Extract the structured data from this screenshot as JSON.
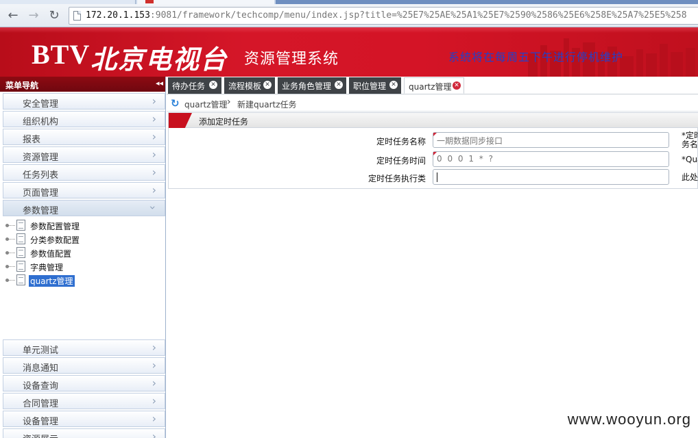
{
  "browser": {
    "url_host": "172.20.1.153",
    "url_rest": ":9081/framework/techcomp/menu/index.jsp?title=%25E7%25AE%25A1%25E7%2590%2586%25E6%258E%25A7%25E5%258"
  },
  "banner": {
    "logo_btv": "BTV",
    "logo_cn": "北京电视台",
    "system_name": "资源管理系统",
    "maintenance_notice": "系统将在每周五下午进行停机维护"
  },
  "sidebar": {
    "title": "菜单导航",
    "collapse_glyph": "◂◂",
    "groups_top": [
      "安全管理",
      "组织机构",
      "报表",
      "资源管理",
      "任务列表",
      "页面管理",
      "参数管理"
    ],
    "tree_items": [
      "参数配置管理",
      "分类参数配置",
      "参数值配置",
      "字典管理",
      "quartz管理"
    ],
    "groups_bottom": [
      "单元测试",
      "消息通知",
      "设备查询",
      "合同管理",
      "设备管理",
      "资源展示"
    ]
  },
  "tabs": [
    {
      "label": "待办任务"
    },
    {
      "label": "流程模板"
    },
    {
      "label": "业务角色管理"
    },
    {
      "label": "职位管理"
    },
    {
      "label": "quartz管理"
    }
  ],
  "breadcrumb": {
    "level1": "quartz管理",
    "separator": "›",
    "level2": "新建quartz任务"
  },
  "form": {
    "title": "添加定时任务",
    "fields": [
      {
        "label": "定时任务名称",
        "value": "一期数据同步接口",
        "hint": "*定时\n务名"
      },
      {
        "label": "定时任务时间",
        "value": "0 0 0 1 * ?",
        "hint": "*Qua"
      },
      {
        "label": "定时任务执行类",
        "value": "",
        "hint": "此处"
      }
    ]
  },
  "watermark": "www.wooyun.org",
  "colors": {
    "banner_red": "#d51628",
    "sidebar_head": "#8e0a12",
    "tab_dark": "#3f4347",
    "accent_red": "#d0283a",
    "notice_blue": "#2340c8"
  }
}
